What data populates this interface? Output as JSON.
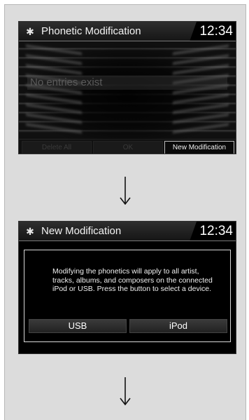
{
  "screen1": {
    "title": "Phonetic Modification",
    "time": "12:34",
    "message": "No entries exist",
    "softkeys": [
      "Delete All",
      "OK",
      "New Modification"
    ]
  },
  "screen2": {
    "title": "New Modification",
    "time": "12:34",
    "message": "Modifying the phonetics will apply to all artist, tracks, albums, and composers on the connected iPod or USB. Press the button to select a device.",
    "options": [
      "USB",
      "iPod"
    ]
  },
  "icons": {
    "title_icon": "gear-icon",
    "flow_arrow": "down-arrow-icon"
  },
  "colors": {
    "screen_bg": "#000000",
    "page_bg": "#dcdcdc",
    "text": "#f0f0f0",
    "disabled_text": "#3a3a3a"
  }
}
